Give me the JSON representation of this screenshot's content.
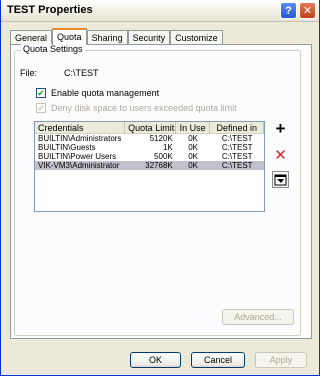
{
  "window": {
    "title": "TEST Properties"
  },
  "tabs": [
    {
      "label": "General"
    },
    {
      "label": "Quota"
    },
    {
      "label": "Sharing"
    },
    {
      "label": "Security"
    },
    {
      "label": "Customize"
    }
  ],
  "quota": {
    "group_title": "Quota Settings",
    "file_label": "File:",
    "file_value": "C:\\TEST",
    "enable_label": "Enable quota management",
    "enable_checked": true,
    "deny_label": "Deny disk space to users exceeded quota limit",
    "deny_checked": true,
    "deny_disabled": true
  },
  "table": {
    "columns": [
      "Credentials",
      "Quota Limit",
      "In Use",
      "Defined in"
    ],
    "rows": [
      {
        "credentials": "BUILTIN\\Administrators",
        "limit": "5120K",
        "inuse": "0K",
        "defined": "C:\\TEST"
      },
      {
        "credentials": "BUILTIN\\Guests",
        "limit": "1K",
        "inuse": "0K",
        "defined": "C:\\TEST"
      },
      {
        "credentials": "BUILTIN\\Power Users",
        "limit": "500K",
        "inuse": "0K",
        "defined": "C:\\TEST"
      },
      {
        "credentials": "VIK-VM3\\Administrator",
        "limit": "32768K",
        "inuse": "0K",
        "defined": "C:\\TEST"
      }
    ]
  },
  "side_buttons": {
    "add_glyph": "+",
    "delete_glyph": "✕"
  },
  "buttons": {
    "advanced": "Advanced...",
    "ok": "OK",
    "cancel": "Cancel",
    "apply": "Apply"
  },
  "title_buttons": {
    "help": "?",
    "close": "✕"
  }
}
